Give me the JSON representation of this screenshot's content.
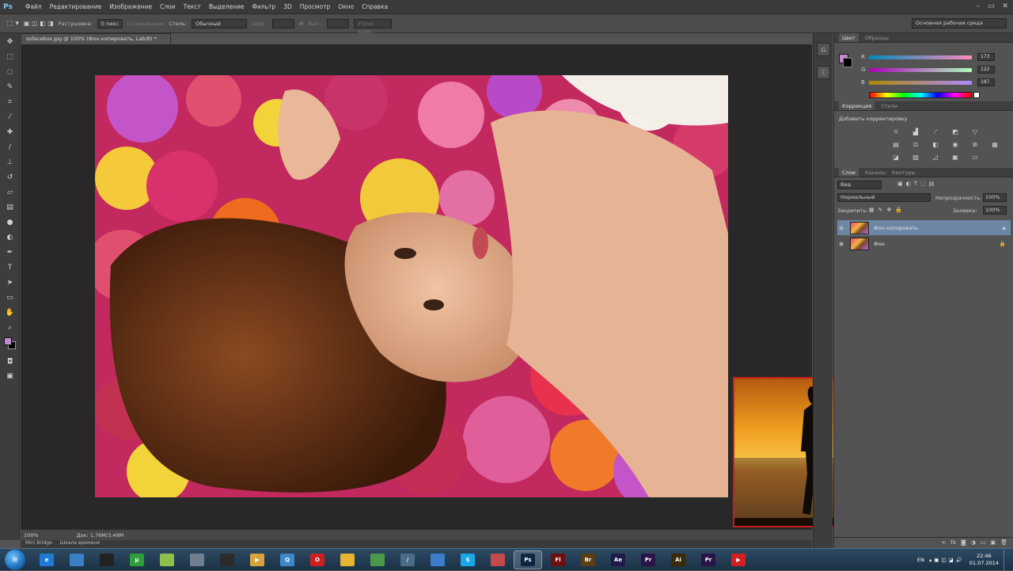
{
  "app": {
    "logo": "Ps"
  },
  "menu": [
    "Файл",
    "Редактирование",
    "Изображение",
    "Слои",
    "Текст",
    "Выделение",
    "Фильтр",
    "3D",
    "Просмотр",
    "Окно",
    "Справка"
  ],
  "options_bar": {
    "feather_label": "Растушевка:",
    "feather_value": "0 пикс",
    "antialias_label": "Сглаживание",
    "style_label": "Стиль:",
    "style_value": "Обычный",
    "width_label": "Шир.:",
    "height_label": "Выс.:",
    "refine_edge": "Уточн. край...",
    "workspace": "Основная рабочая среда"
  },
  "document": {
    "tab_title": "sofacebox.jpg @ 100% (Фон копировать, Lab/8) *",
    "zoom": "100%",
    "doc_info": "Док: 1,76M/3,49M"
  },
  "mini_bridge": [
    "Mini Bridge",
    "Шкала времени"
  ],
  "color_panel": {
    "tabs": [
      "Цвет",
      "Образцы"
    ],
    "values": [
      "173",
      "122",
      "187"
    ],
    "foreground_color": "#c38ad0"
  },
  "adjustments_panel": {
    "tabs": [
      "Коррекция",
      "Стили"
    ],
    "title": "Добавить корректировку"
  },
  "layers_panel": {
    "tabs": [
      "Слои",
      "Каналы",
      "Контуры"
    ],
    "filter_kind": "Вид",
    "blend_mode": "Нормальный",
    "opacity_label": "Непрозрачность:",
    "opacity_value": "100%",
    "lock_label": "Закрепить:",
    "fill_label": "Заливка:",
    "fill_value": "100%",
    "layers": [
      {
        "name": "Фон копировать",
        "selected": true
      },
      {
        "name": "Фон",
        "selected": false
      }
    ]
  },
  "taskbar": {
    "apps": [
      {
        "name": "IE",
        "label": "e",
        "color": "#1f7ad6"
      },
      {
        "name": "Explorer",
        "label": "",
        "color": "#3b7fc4"
      },
      {
        "name": "Media",
        "label": "",
        "color": "#222222"
      },
      {
        "name": "uTorrent",
        "label": "µ",
        "color": "#2e9f3a"
      },
      {
        "name": "Folder",
        "label": "",
        "color": "#8fbf4b"
      },
      {
        "name": "Recorder",
        "label": "",
        "color": "#6f7f8f"
      },
      {
        "name": "Dark",
        "label": "",
        "color": "#2b2b2b"
      },
      {
        "name": "Player",
        "label": "▶",
        "color": "#d8a33a"
      },
      {
        "name": "Search",
        "label": "Q",
        "color": "#3c89c7"
      },
      {
        "name": "Opera",
        "label": "O",
        "color": "#cc1f1f"
      },
      {
        "name": "Chrome",
        "label": "",
        "color": "#e5b531"
      },
      {
        "name": "Green",
        "label": "",
        "color": "#4a9a4a"
      },
      {
        "name": "Pen",
        "label": "/",
        "color": "#4c6b87"
      },
      {
        "name": "Doc",
        "label": "",
        "color": "#3a7dc8"
      },
      {
        "name": "S",
        "label": "S",
        "color": "#1aa9e8"
      },
      {
        "name": "Network",
        "label": "",
        "color": "#c24a4a"
      },
      {
        "name": "Ps",
        "label": "Ps",
        "color": "#0d2743"
      },
      {
        "name": "Fl",
        "label": "Fl",
        "color": "#6b0f0f"
      },
      {
        "name": "Br",
        "label": "Br",
        "color": "#5b3d12"
      },
      {
        "name": "Ae",
        "label": "Ae",
        "color": "#1d1a4a"
      },
      {
        "name": "Pr",
        "label": "Pr",
        "color": "#2a1447"
      },
      {
        "name": "Ai",
        "label": "Ai",
        "color": "#3b2a08"
      },
      {
        "name": "Pr2",
        "label": "Pr",
        "color": "#2a1447"
      },
      {
        "name": "YouTube",
        "label": "▶",
        "color": "#d21f1f"
      }
    ],
    "lang": "EN",
    "time": "22:46",
    "date": "01.07.2014"
  }
}
